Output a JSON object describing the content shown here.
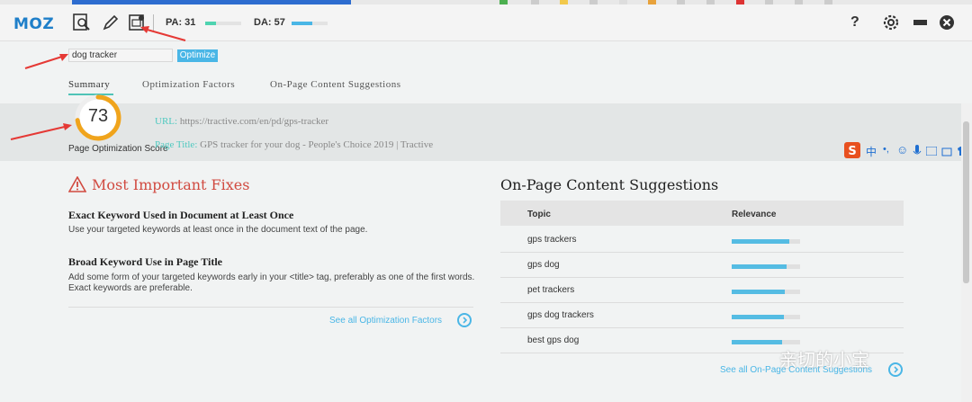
{
  "toolbar": {
    "logo": "MOZ",
    "pa_label": "PA: 31",
    "pa_value": 31,
    "da_label": "DA: 57",
    "da_value": 57,
    "help": "?"
  },
  "keyword": {
    "value": "dog tracker",
    "optimize_label": "Optimize"
  },
  "tabs": [
    {
      "label": "Summary",
      "active": true
    },
    {
      "label": "Optimization Factors",
      "active": false
    },
    {
      "label": "On-Page Content Suggestions",
      "active": false
    }
  ],
  "score": {
    "value": "73",
    "label": "Page Optimization Score",
    "url_key": "URL:",
    "url": "https://tractive.com/en/pd/gps-tracker",
    "title_key": "Page Title:",
    "title": "GPS tracker for your dog - People's Choice 2019 | Tractive"
  },
  "fixes": {
    "title": "Most Important Fixes",
    "items": [
      {
        "heading": "Exact Keyword Used in Document at Least Once",
        "desc": "Use your targeted keywords at least once in the document text of the page."
      },
      {
        "heading": "Broad Keyword Use in Page Title",
        "desc": "Add some form of your targeted keywords early in your <title> tag, preferably as one of the first words. Exact keywords are preferable."
      }
    ],
    "see_all": "See all Optimization Factors"
  },
  "suggestions": {
    "title": "On-Page Content Suggestions",
    "col_topic": "Topic",
    "col_relevance": "Relevance",
    "rows": [
      {
        "topic": "gps trackers",
        "relevance": 0.84
      },
      {
        "topic": "gps dog",
        "relevance": 0.8
      },
      {
        "topic": "pet trackers",
        "relevance": 0.78
      },
      {
        "topic": "gps dog trackers",
        "relevance": 0.76
      },
      {
        "topic": "best gps dog",
        "relevance": 0.74
      }
    ],
    "see_all": "See all On-Page Content Suggestions"
  },
  "watermark": "亲切的小宝",
  "ime": {
    "label": "中"
  },
  "colors": {
    "accent": "#4ab6e6",
    "teal": "#4fc9c0",
    "red": "#d14a40",
    "score_ring": "#f0a41c"
  }
}
